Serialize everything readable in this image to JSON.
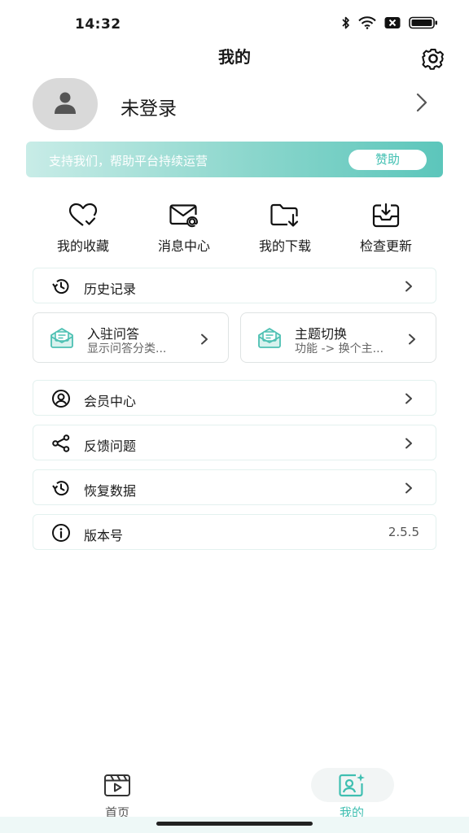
{
  "status_bar": {
    "time": "14:32",
    "icons": [
      "bluetooth-icon",
      "wifi-icon",
      "close-box-icon",
      "battery-icon"
    ]
  },
  "header": {
    "title": "我的",
    "settings_icon": "gear-icon"
  },
  "profile": {
    "avatar_icon": "user-icon",
    "login_text": "未登录"
  },
  "sponsor": {
    "text": "支持我们，帮助平台持续运营",
    "button_label": "赞助"
  },
  "quick_actions": [
    {
      "label": "我的收藏",
      "icon": "heart-check-icon"
    },
    {
      "label": "消息中心",
      "icon": "mail-at-icon"
    },
    {
      "label": "我的下载",
      "icon": "folder-download-icon"
    },
    {
      "label": "检查更新",
      "icon": "inbox-download-icon"
    }
  ],
  "history": {
    "label": "历史记录",
    "icon": "history-icon"
  },
  "half_cards": [
    {
      "title": "入驻问答",
      "subtitle": "显示问答分类...",
      "icon": "mail-open-icon"
    },
    {
      "title": "主题切换",
      "subtitle": "功能 -> 换个主...",
      "icon": "mail-open-icon"
    }
  ],
  "menu": [
    {
      "label": "会员中心",
      "icon": "user-circle-icon"
    },
    {
      "label": "反馈问题",
      "icon": "share-icon"
    },
    {
      "label": "恢复数据",
      "icon": "history-icon"
    },
    {
      "label": "版本号",
      "icon": "info-icon",
      "value": "2.5.5"
    }
  ],
  "tabs": [
    {
      "label": "首页",
      "icon": "video-icon",
      "active": false
    },
    {
      "label": "我的",
      "icon": "profile-sparkle-icon",
      "active": true
    }
  ],
  "colors": {
    "accent": "#3fbfb1",
    "banner_start": "#c8ece7",
    "banner_end": "#5cc6bb",
    "card_border": "#e3f1ef"
  }
}
